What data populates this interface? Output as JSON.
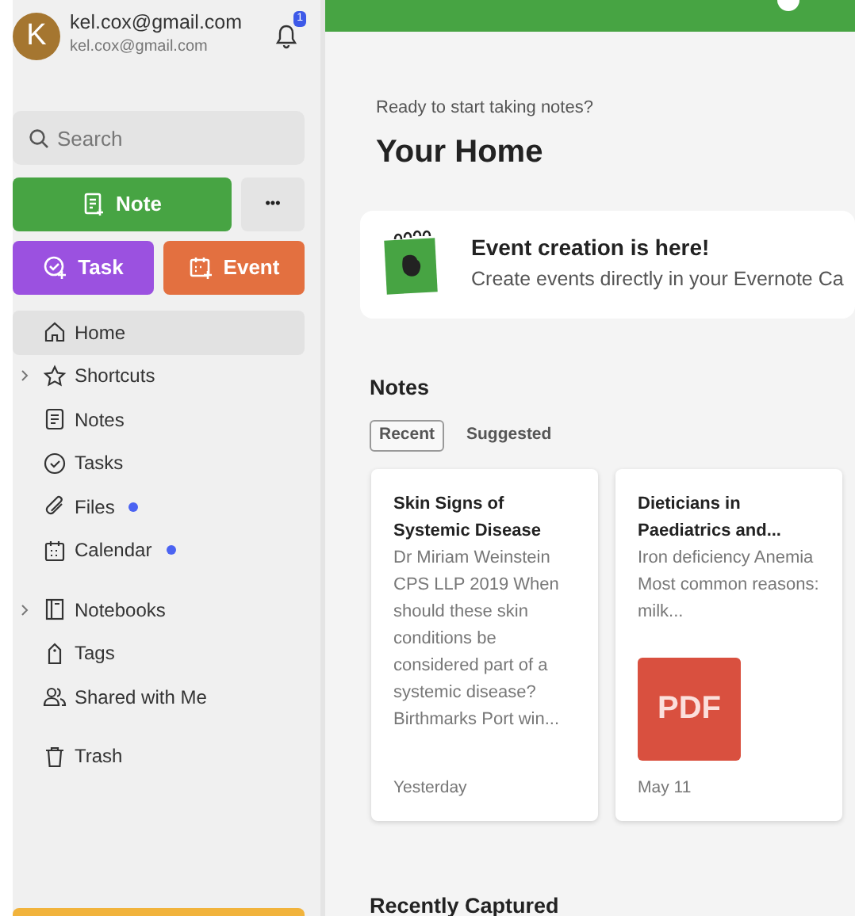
{
  "account": {
    "initial": "K",
    "name": "kel.cox@gmail.com",
    "email": "kel.cox@gmail.com",
    "notification_count": "1"
  },
  "search": {
    "placeholder": "Search"
  },
  "create_buttons": [
    {
      "kind": "note",
      "label": "Note"
    },
    {
      "kind": "more",
      "label": "•••"
    },
    {
      "kind": "task",
      "label": "Task"
    },
    {
      "kind": "event",
      "label": "Event"
    }
  ],
  "nav_groups": [
    [
      {
        "kind": "home",
        "label": "Home",
        "selected": true,
        "expandable": false,
        "new_dot": false
      },
      {
        "kind": "shortcuts",
        "label": "Shortcuts",
        "selected": false,
        "expandable": true,
        "new_dot": false
      },
      {
        "kind": "notes",
        "label": "Notes",
        "selected": false,
        "expandable": false,
        "new_dot": false
      },
      {
        "kind": "tasks",
        "label": "Tasks",
        "selected": false,
        "expandable": false,
        "new_dot": false
      },
      {
        "kind": "files",
        "label": "Files",
        "selected": false,
        "expandable": false,
        "new_dot": true
      },
      {
        "kind": "calendar",
        "label": "Calendar",
        "selected": false,
        "expandable": false,
        "new_dot": true
      }
    ],
    [
      {
        "kind": "notebooks",
        "label": "Notebooks",
        "selected": false,
        "expandable": true,
        "new_dot": false
      },
      {
        "kind": "tags",
        "label": "Tags",
        "selected": false,
        "expandable": false,
        "new_dot": false
      },
      {
        "kind": "shared",
        "label": "Shared with Me",
        "selected": false,
        "expandable": false,
        "new_dot": false
      }
    ],
    [
      {
        "kind": "trash",
        "label": "Trash",
        "selected": false,
        "expandable": false,
        "new_dot": false
      }
    ]
  ],
  "home": {
    "subtitle": "Ready to start taking notes?",
    "title": "Your Home"
  },
  "banner": {
    "title": "Event creation is here!",
    "text": "Create events directly in your Evernote Ca"
  },
  "notes_section": {
    "title": "Notes",
    "tabs": [
      {
        "label": "Recent",
        "selected": true
      },
      {
        "label": "Suggested",
        "selected": false
      }
    ],
    "cards": [
      {
        "title": "Skin Signs of Systemic Disease",
        "snippet": "Dr Miriam Weinstein CPS LLP 2019 When should these skin conditions be considered part of a systemic disease? Birthmarks Port win...",
        "date": "Yesterday"
      },
      {
        "title": "Dieticians in Paediatrics and...",
        "snippet": "Iron deficiency Anemia Most common reasons: milk...",
        "attachment": "PDF",
        "date": "May 11"
      }
    ]
  },
  "recent_section": {
    "title": "Recently Captured"
  }
}
